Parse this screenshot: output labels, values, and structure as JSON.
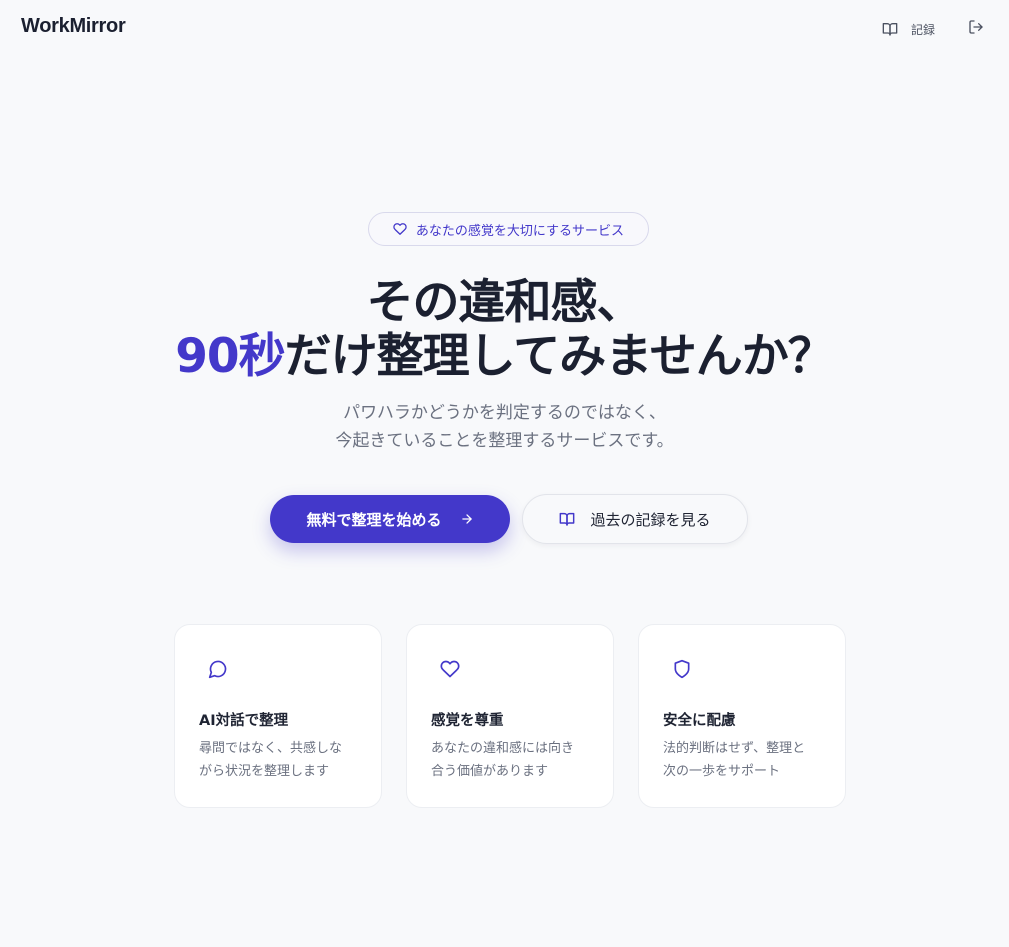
{
  "header": {
    "brand": "WorkMirror",
    "records_label": "記録",
    "records_icon": "book-open-icon",
    "logout_icon": "log-out-icon"
  },
  "hero": {
    "badge_icon": "heart-icon",
    "badge_text": "あなたの感覚を大切にするサービス",
    "headline_line1": "その違和感、",
    "headline_accent": "90秒",
    "headline_line2_rest": "だけ整理してみませんか？",
    "subtext_line1": "パワハラかどうかを判定するのではなく、",
    "subtext_line2": "今起きていることを整理するサービスです。",
    "primary_button_label": "無料で整理を始める",
    "primary_button_icon": "arrow-right-icon",
    "secondary_button_label": "過去の記録を見る",
    "secondary_button_icon": "book-open-icon"
  },
  "features": [
    {
      "icon": "message-circle-icon",
      "title": "AI対話で整理",
      "desc_line1": "尋問ではなく、共感しな",
      "desc_line2": "がら状況を整理します"
    },
    {
      "icon": "heart-icon",
      "title": "感覚を尊重",
      "desc_line1": "あなたの違和感には向き",
      "desc_line2": "合う価値があります"
    },
    {
      "icon": "shield-icon",
      "title": "安全に配慮",
      "desc_line1": "法的判断はせず、整理と",
      "desc_line2": "次の一歩をサポート"
    }
  ],
  "colors": {
    "accent": "#4338ca",
    "background": "#f8f9fb",
    "text_dark": "#1b2030",
    "text_muted": "#6b7180"
  }
}
